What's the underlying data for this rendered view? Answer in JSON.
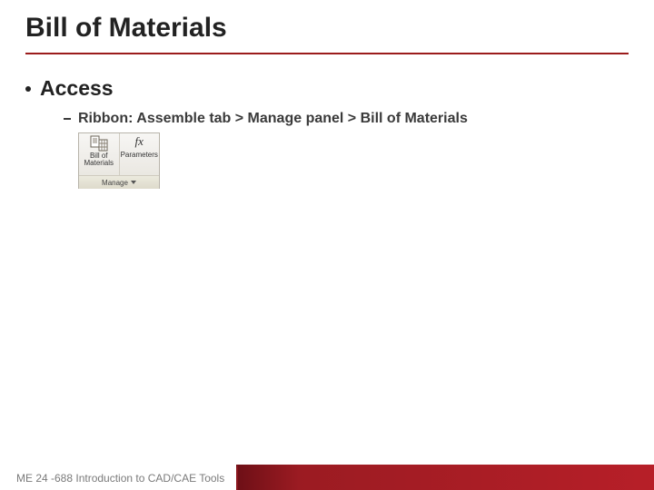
{
  "title": "Bill of Materials",
  "bullets": {
    "level1": "Access",
    "level2": "Ribbon: Assemble tab > Manage panel > Bill of Materials"
  },
  "ribbon": {
    "btn1_line1": "Bill of",
    "btn1_line2": "Materials",
    "btn2": "Parameters",
    "fx": "fx",
    "footer": "Manage"
  },
  "footer": "ME 24 -688 Introduction to CAD/CAE Tools",
  "colors": {
    "accent": "#9b1c1c"
  }
}
